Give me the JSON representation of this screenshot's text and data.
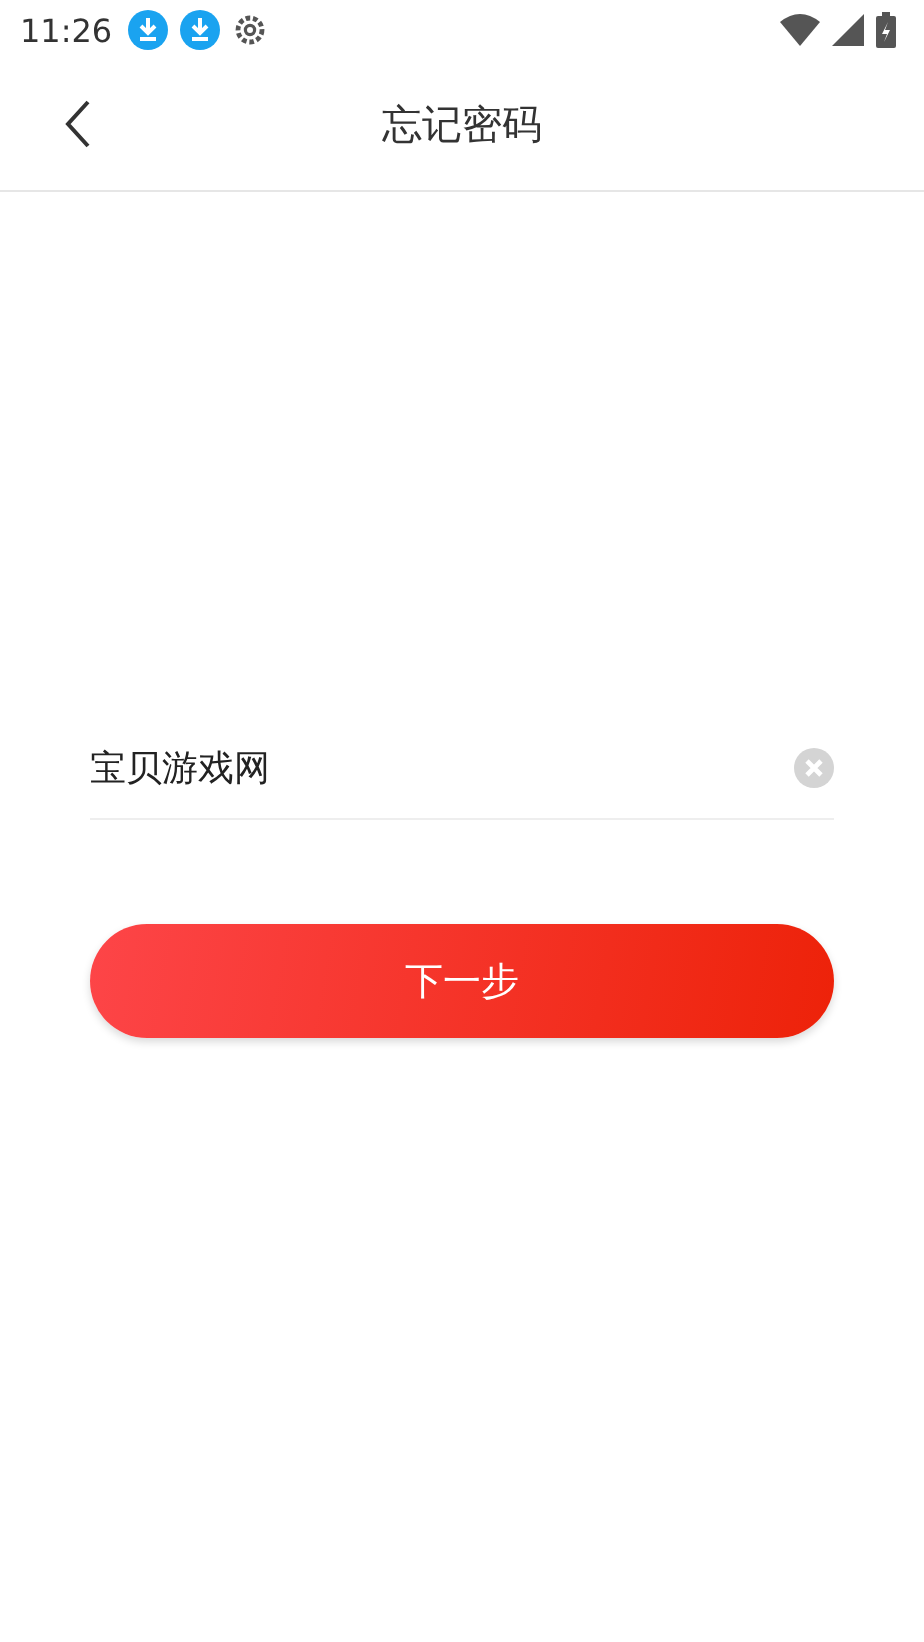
{
  "status_bar": {
    "time": "11:26"
  },
  "header": {
    "title": "忘记密码"
  },
  "field": {
    "value": "宝贝游戏网"
  },
  "button": {
    "label": "下一步"
  }
}
